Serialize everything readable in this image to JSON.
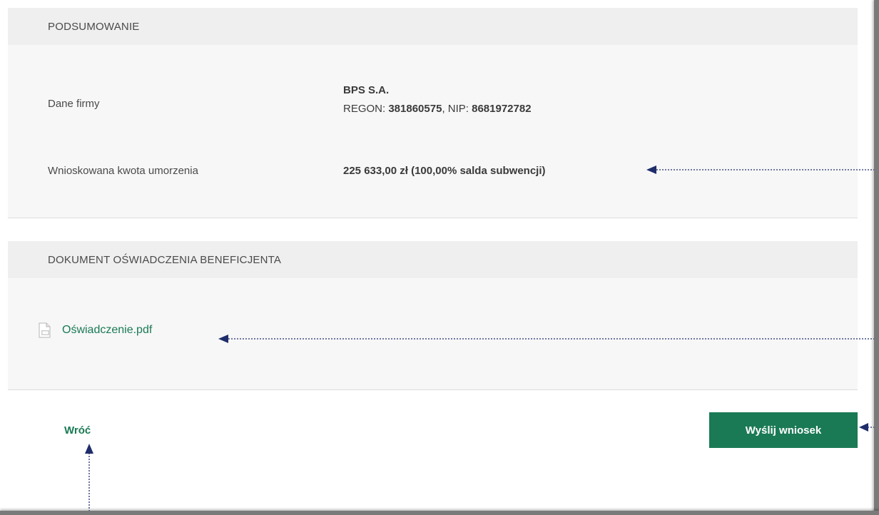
{
  "summary": {
    "header": "PODSUMOWANIE",
    "company_label": "Dane firmy",
    "company_name": "BPS S.A.",
    "regon_label": "REGON: ",
    "regon_value": "381860575",
    "separator": ", ",
    "nip_label": "NIP: ",
    "nip_value": "8681972782",
    "amount_label": "Wnioskowana kwota umorzenia",
    "amount_value": "225 633,00 zł (100,00% salda subwencji)"
  },
  "document": {
    "header": "DOKUMENT OŚWIADCZENIA BENEFICJENTA",
    "file_name": "Oświadczenie.pdf",
    "file_icon": "pdf-file-icon"
  },
  "actions": {
    "back_label": "Wróć",
    "submit_label": "Wyślij wniosek"
  },
  "colors": {
    "accent": "#1a7a55",
    "header_bg": "#efefef",
    "card_bg": "#f7f7f7",
    "annotation": "#1f2d6b"
  }
}
